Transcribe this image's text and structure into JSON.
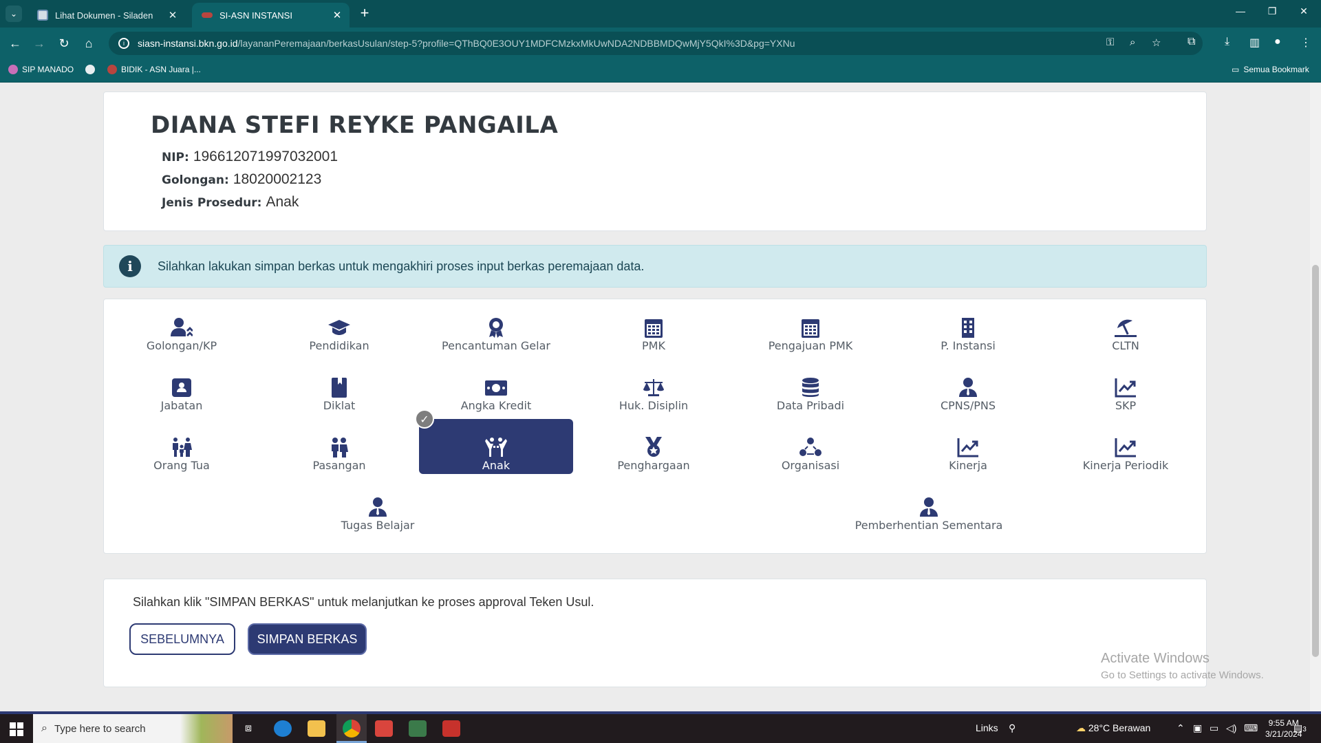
{
  "browser": {
    "tabs": [
      {
        "title": "Lihat Dokumen - Siladen"
      },
      {
        "title": "SI-ASN INSTANSI"
      }
    ],
    "url_host": "siasn-instansi.bkn.go.id",
    "url_path": "/layananPeremajaan/berkasUsulan/step-5?profile=QThBQ0E3OUY1MDFCMzkxMkUwNDA2NDBBMDQwMjY5QkI%3D&pg=YXNu",
    "bookmarks": [
      {
        "label": "SIP MANADO"
      },
      {
        "label": "BIDIK - ASN Juara |..."
      }
    ],
    "all_bookmarks": "Semua Bookmark"
  },
  "profile": {
    "name": "DIANA STEFI REYKE PANGAILA",
    "nip_label": "NIP:",
    "nip": "196612071997032001",
    "golongan_label": "Golongan:",
    "golongan": "18020002123",
    "prosedur_label": "Jenis Prosedur:",
    "prosedur": "Anak"
  },
  "alert": {
    "text": "Silahkan lakukan simpan berkas untuk mengakhiri proses input berkas peremajaan data."
  },
  "menu": {
    "items": [
      {
        "label": "Golongan/KP",
        "icon": "user-up-icon"
      },
      {
        "label": "Pendidikan",
        "icon": "graduation-cap-icon"
      },
      {
        "label": "Pencantuman Gelar",
        "icon": "award-icon"
      },
      {
        "label": "PMK",
        "icon": "calendar-icon"
      },
      {
        "label": "Pengajuan PMK",
        "icon": "calendar-icon"
      },
      {
        "label": "P. Instansi",
        "icon": "building-icon"
      },
      {
        "label": "CLTN",
        "icon": "umbrella-beach-icon"
      },
      {
        "label": "Jabatan",
        "icon": "id-badge-icon"
      },
      {
        "label": "Diklat",
        "icon": "book-icon"
      },
      {
        "label": "Angka Kredit",
        "icon": "money-bill-icon"
      },
      {
        "label": "Huk. Disiplin",
        "icon": "balance-scale-icon"
      },
      {
        "label": "Data Pribadi",
        "icon": "database-icon"
      },
      {
        "label": "CPNS/PNS",
        "icon": "user-tie-icon"
      },
      {
        "label": "SKP",
        "icon": "chart-line-icon"
      },
      {
        "label": "Orang Tua",
        "icon": "family-icon"
      },
      {
        "label": "Pasangan",
        "icon": "couple-icon"
      },
      {
        "label": "Anak",
        "icon": "child-icon",
        "active": true
      },
      {
        "label": "Penghargaan",
        "icon": "medal-icon"
      },
      {
        "label": "Organisasi",
        "icon": "people-group-icon"
      },
      {
        "label": "Kinerja",
        "icon": "chart-line-icon"
      },
      {
        "label": "Kinerja Periodik",
        "icon": "chart-line-icon"
      },
      {
        "label": "Tugas Belajar",
        "icon": "user-tie-icon"
      },
      {
        "label": "Pemberhentian Sementara",
        "icon": "user-tie-icon"
      }
    ],
    "check_mark": "✓"
  },
  "actions": {
    "text": "Silahkan klik \"SIMPAN BERKAS\" untuk melanjutkan ke proses approval Teken Usul.",
    "prev_label": "SEBELUMNYA",
    "save_label": "SIMPAN BERKAS"
  },
  "watermark": {
    "title": "Activate Windows",
    "subtitle": "Go to Settings to activate Windows."
  },
  "taskbar": {
    "search_placeholder": "Type here to search",
    "links": "Links",
    "weather": "28°C  Berawan",
    "time": "9:55 AM",
    "date": "3/21/2024",
    "notifications": "3"
  },
  "colors": {
    "primary": "#2d3a73",
    "browser_teal": "#0d6168",
    "alert_bg": "#d0eaee"
  }
}
